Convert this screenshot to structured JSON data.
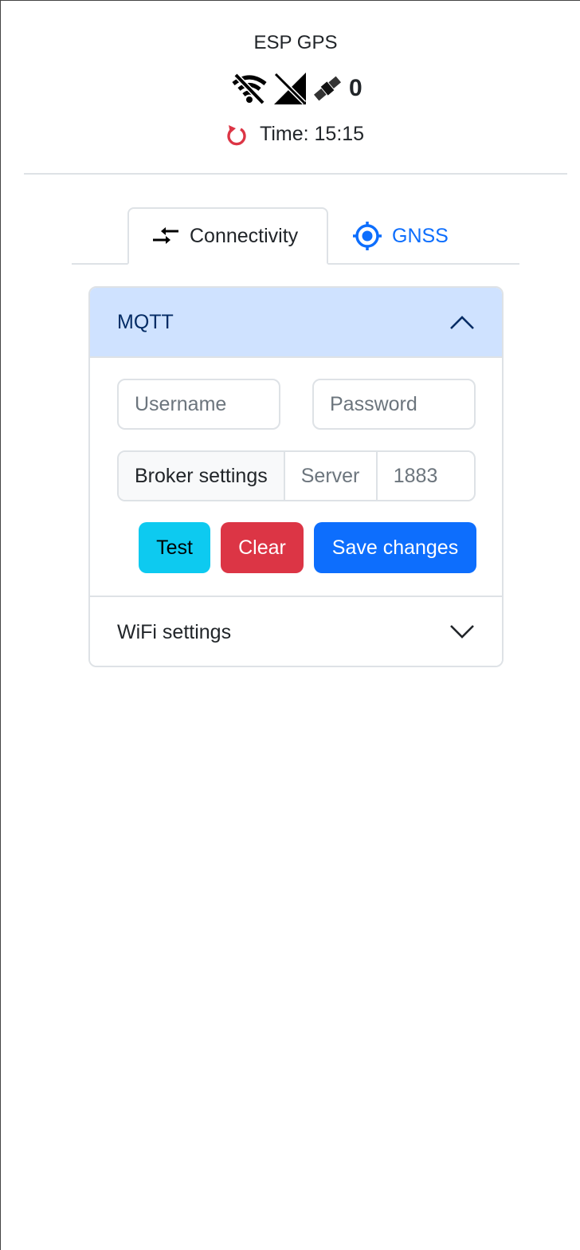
{
  "app": {
    "title": "ESP GPS"
  },
  "status": {
    "wifi_icon": "wifi-off-icon",
    "signal_icon": "cell-signal-off-icon",
    "satellite_icon": "satellite-icon",
    "satellite_count": "0",
    "time_label": "Time: 15:15",
    "refresh_icon": "refresh-icon"
  },
  "tabs": [
    {
      "label": "Connectivity",
      "icon": "arrows-exchange-icon",
      "active": true
    },
    {
      "label": "GNSS",
      "icon": "crosshair-icon",
      "active": false
    }
  ],
  "accordion": {
    "mqtt": {
      "title": "MQTT",
      "username_placeholder": "Username",
      "password_placeholder": "Password",
      "broker_label": "Broker settings",
      "server_placeholder": "Server",
      "port_placeholder": "1883",
      "test_label": "Test",
      "clear_label": "Clear",
      "save_label": "Save changes"
    },
    "wifi": {
      "title": "WiFi settings"
    }
  },
  "colors": {
    "primary": "#0d6efd",
    "info": "#0dcaf0",
    "danger": "#dc3545",
    "accordion_active_bg": "#cfe2ff",
    "accordion_active_text": "#052c65"
  }
}
